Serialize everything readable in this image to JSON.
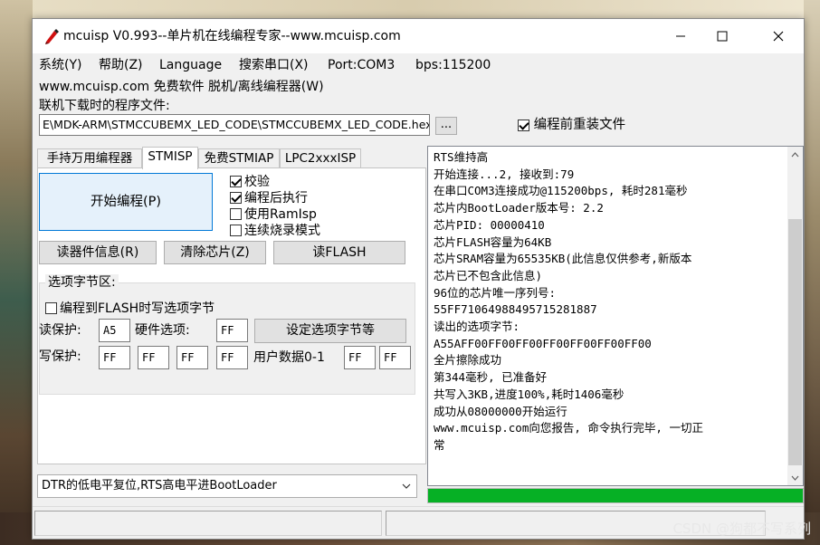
{
  "window": {
    "title": "mcuisp V0.993--单片机在线编程专家--www.mcuisp.com",
    "app_icon": "mcuisp-pen-icon"
  },
  "menubar": {
    "items": [
      "系统(Y)",
      "帮助(Z)",
      "Language",
      "搜索串口(X)",
      "Port:COM3",
      "bps:115200"
    ]
  },
  "subbar": {
    "text": "www.mcuisp.com 免费软件 脱机/离线编程器(W)"
  },
  "file": {
    "label": "联机下载时的程序文件:",
    "path": "E\\MDK-ARM\\STMCCUBEMX_LED_CODE\\STMCCUBEMX_LED_CODE.hex",
    "browse_label": "...",
    "reinstall_label": "编程前重装文件",
    "reinstall_checked": true
  },
  "tabs": [
    {
      "label": "手持万用编程器",
      "active": false
    },
    {
      "label": "STMISP",
      "active": true
    },
    {
      "label": "免费STMIAP",
      "active": false
    },
    {
      "label": "LPC2xxxISP",
      "active": false
    }
  ],
  "stmisp": {
    "start_label": "开始编程(P)",
    "options": [
      {
        "label": "校验",
        "checked": true
      },
      {
        "label": "编程后执行",
        "checked": true
      },
      {
        "label": "使用RamIsp",
        "checked": false
      },
      {
        "label": "连续烧录模式",
        "checked": false
      }
    ],
    "read_info_label": "读器件信息(R)",
    "erase_label": "清除芯片(Z)",
    "read_flash_label": "读FLASH",
    "option_group": {
      "title": "选项字节区:",
      "flash_write_label": "编程到FLASH时写选项字节",
      "flash_write_checked": false,
      "read_protect_label": "读保护:",
      "read_protect_value": "A5",
      "hw_option_label": "硬件选项:",
      "hw_option_value": "FF",
      "set_option_label": "设定选项字节等",
      "write_protect_label": "写保护:",
      "write_protect_values": [
        "FF",
        "FF",
        "FF",
        "FF"
      ],
      "user_data_label": "用户数据0-1",
      "user_data_values": [
        "FF",
        "FF"
      ]
    }
  },
  "reset_mode": {
    "selected": "DTR的低电平复位,RTS高电平进BootLoader"
  },
  "log": {
    "lines": [
      "RTS维持高",
      "开始连接...2, 接收到:79",
      "在串口COM3连接成功@115200bps, 耗时281毫秒",
      "芯片内BootLoader版本号: 2.2",
      "芯片PID: 00000410",
      "芯片FLASH容量为64KB",
      "芯片SRAM容量为65535KB(此信息仅供参考,新版本",
      "芯片已不包含此信息)",
      "96位的芯片唯一序列号:",
      "55FF71064988495715281887",
      "读出的选项字节:",
      "A55AFF00FF00FF00FF00FF00FF00FF00",
      "全片擦除成功",
      "第344毫秒, 已准备好",
      "共写入3KB,进度100%,耗时1406毫秒",
      "成功从08000000开始运行",
      "www.mcuisp.com向您报告, 命令执行完毕, 一切正",
      "常"
    ]
  },
  "progress": {
    "value": 1.0,
    "color": "#06b025"
  },
  "watermark": "CSDN @狗都不写系列",
  "colors": {
    "accent_border": "#0078d7",
    "button_hover_bg": "#e5f1fb"
  }
}
